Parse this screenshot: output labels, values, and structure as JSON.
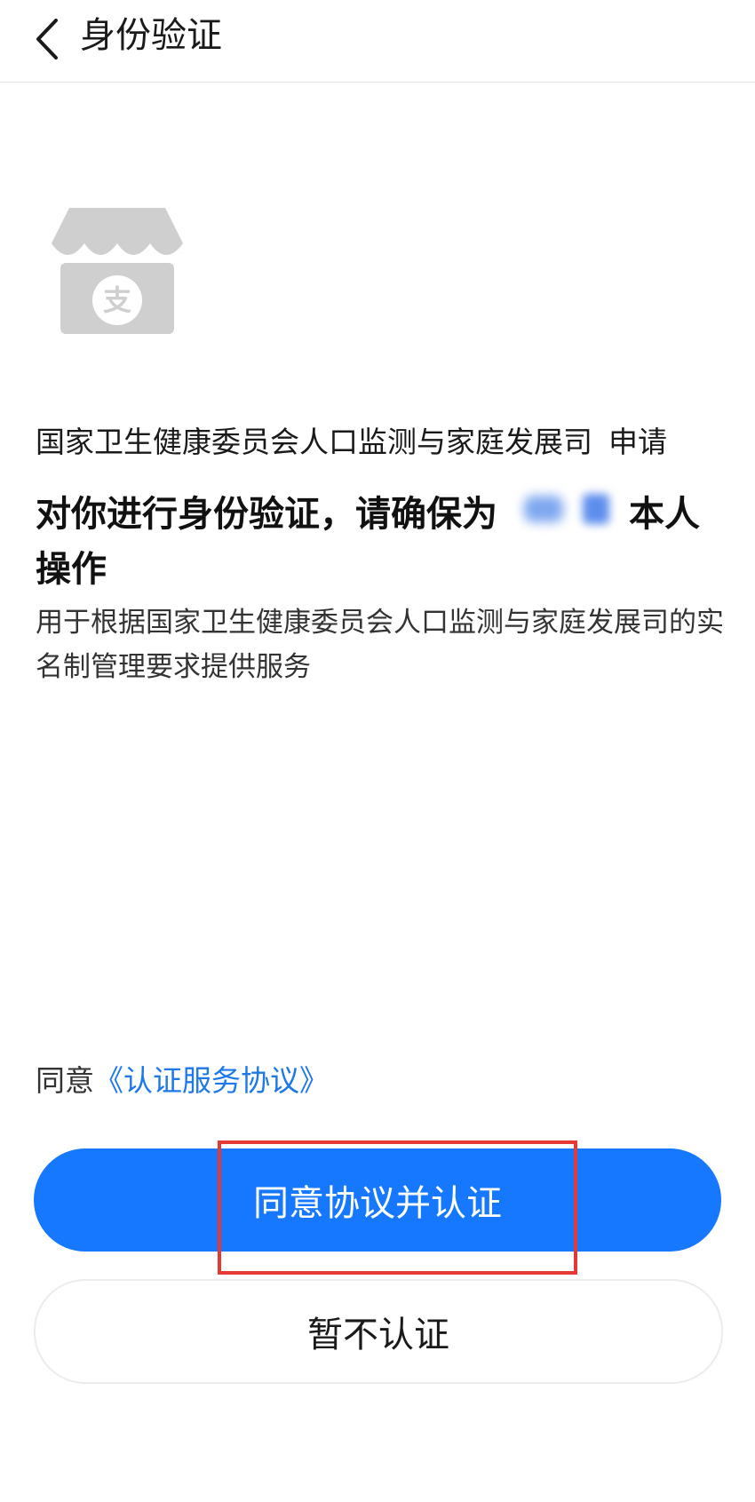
{
  "nav": {
    "back_icon": "chevron-left-icon",
    "title": "身份验证"
  },
  "logo": {
    "icon": "alipay-store-icon",
    "glyph": "支",
    "color": "#cfcfcf"
  },
  "applicant": {
    "org_name": "国家卫生健康委员会人口监测与家庭发展司",
    "action": "申请"
  },
  "headline": {
    "text_before_name": "对你进行身份验证，请确保为",
    "text_after_name": "本人操作"
  },
  "description": "用于根据国家卫生健康委员会人口监测与家庭发展司的实名制管理要求提供服务",
  "agreement": {
    "prefix": "同意",
    "link_text": "《认证服务协议》",
    "link_color": "#1e78e8"
  },
  "buttons": {
    "primary_label": "同意协议并认证",
    "secondary_label": "暂不认证",
    "primary_color": "#1677ff"
  },
  "annotation": {
    "highlight_color": "#e53935"
  }
}
